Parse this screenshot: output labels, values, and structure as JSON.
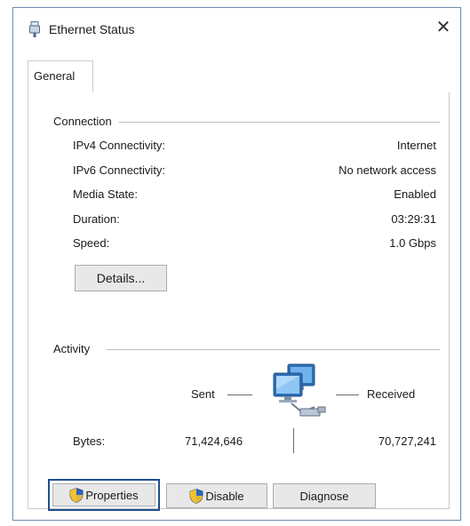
{
  "window": {
    "title": "Ethernet Status",
    "close_glyph": "✕"
  },
  "tabs": [
    {
      "label": "General",
      "selected": true
    }
  ],
  "connection": {
    "group_title": "Connection",
    "rows": [
      {
        "label": "IPv4 Connectivity:",
        "value": "Internet"
      },
      {
        "label": "IPv6 Connectivity:",
        "value": "No network access"
      },
      {
        "label": "Media State:",
        "value": "Enabled"
      },
      {
        "label": "Duration:",
        "value": "03:29:31"
      },
      {
        "label": "Speed:",
        "value": "1.0 Gbps"
      }
    ],
    "details_button": "Details..."
  },
  "activity": {
    "group_title": "Activity",
    "sent_label": "Sent",
    "received_label": "Received",
    "bytes_label": "Bytes:",
    "bytes_sent": "71,424,646",
    "bytes_received": "70,727,241",
    "icon": "network-computers-icon"
  },
  "buttons": {
    "properties": "Properties",
    "disable": "Disable",
    "diagnose": "Diagnose"
  },
  "colors": {
    "window_border": "#6f8fb5",
    "focus_ring": "#1f4e8f",
    "button_face": "#e8e8e8"
  }
}
